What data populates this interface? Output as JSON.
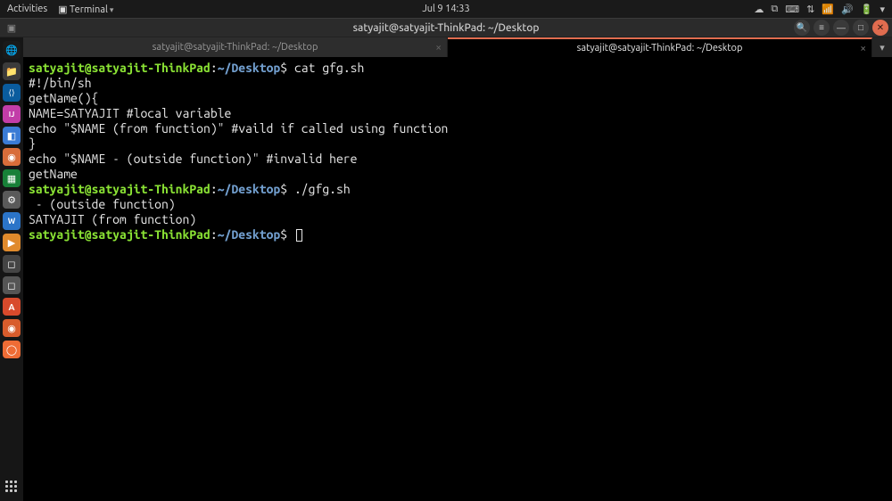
{
  "topbar": {
    "activities": "Activities",
    "app": "Terminal",
    "datetime": "Jul 9  14:33"
  },
  "titlebar": {
    "title": "satyajit@satyajit-ThinkPad: ~/Desktop"
  },
  "tabs": [
    {
      "label": "satyajit@satyajit-ThinkPad: ~/Desktop",
      "active": false
    },
    {
      "label": "satyajit@satyajit-ThinkPad: ~/Desktop",
      "active": true
    }
  ],
  "prompt": {
    "user": "satyajit",
    "at": "@",
    "host": "satyajit-ThinkPad",
    "colon": ":",
    "path": "~/Desktop",
    "dollar": "$"
  },
  "lines": {
    "cmd1": "cat gfg.sh",
    "l1": "#!/bin/sh",
    "l2": "",
    "l3": "getName(){",
    "l4": "NAME=SATYAJIT #local variable",
    "l5": "echo \"$NAME (from function)\" #vaild if called using function",
    "l6": "}",
    "l7": "",
    "l8": "echo \"$NAME - (outside function)\" #invalid here",
    "l9": "getName",
    "cmd2": "./gfg.sh",
    "o1": " - (outside function)",
    "o2": "SATYAJIT (from function)"
  },
  "dock_icons": [
    {
      "name": "firefox",
      "bg": "#1a1a1a",
      "glyph": "🦊"
    },
    {
      "name": "chrome",
      "bg": "#1a1a1a",
      "glyph": "🌐"
    },
    {
      "name": "files",
      "bg": "#3b3b3b",
      "glyph": "📁"
    },
    {
      "name": "vscode",
      "bg": "#0a5c9e",
      "glyph": "⟨⟩"
    },
    {
      "name": "intellij",
      "bg": "#c23da8",
      "glyph": "IJ"
    },
    {
      "name": "app1",
      "bg": "#3a7bd5",
      "glyph": "◧"
    },
    {
      "name": "app2",
      "bg": "#d86d3a",
      "glyph": "◉"
    },
    {
      "name": "sheets",
      "bg": "#188038",
      "glyph": "▦"
    },
    {
      "name": "prefs",
      "bg": "#5a5a5a",
      "glyph": "⚙"
    },
    {
      "name": "writer",
      "bg": "#2b74c8",
      "glyph": "W"
    },
    {
      "name": "vlc",
      "bg": "#e08a2c",
      "glyph": "▶"
    },
    {
      "name": "app3",
      "bg": "#444",
      "glyph": "◻"
    },
    {
      "name": "app4",
      "bg": "#555",
      "glyph": "◻"
    },
    {
      "name": "store",
      "bg": "#d84a2c",
      "glyph": "A"
    },
    {
      "name": "app5",
      "bg": "#d85c2c",
      "glyph": "◉"
    },
    {
      "name": "postman",
      "bg": "#ef6c35",
      "glyph": "◯"
    }
  ]
}
